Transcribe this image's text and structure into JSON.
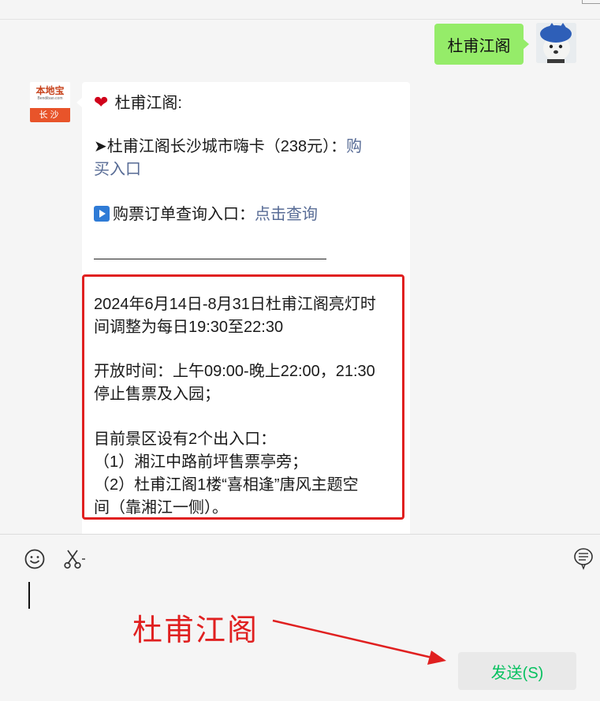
{
  "chat": {
    "outgoing": {
      "text": "杜甫江阁"
    },
    "bot": {
      "avatar": {
        "brand": "本地宝",
        "brand_sub": "Bendibao.com",
        "city": "长沙"
      },
      "heading": "杜甫江阁:",
      "ticket_line": {
        "text": "➤杜甫江阁长沙城市嗨卡（238元）：",
        "link_part1": "购",
        "link_part2": "买入口"
      },
      "order_line": {
        "text": "购票订单查询入口：",
        "link": "点击查询"
      },
      "notice": {
        "line1": "2024年6月14日-8月31日杜甫江阁亮灯时",
        "line2": "间调整为每日19:30至22:30",
        "line3": "开放时间：上午09:00-晚上22:00，21:30",
        "line4": "停止售票及入园；",
        "line5": "目前景区设有2个出入口：",
        "line6": "（1）湘江中路前坪售票亭旁；",
        "line7": "（2）杜甫江阁1楼“喜相逢”唐风主题空",
        "line8": "间（靠湘江一侧）。"
      }
    }
  },
  "toolbar": {
    "emoji_icon": "smiley-icon",
    "scissors_icon": "scissors-icon",
    "history_icon": "chat-history-icon"
  },
  "annotation": {
    "text": "杜甫江阁"
  },
  "send_button": {
    "label": "发送(S)"
  },
  "colors": {
    "accent_green": "#07c160",
    "bubble_green": "#95ec69",
    "link_blue": "#576b95",
    "highlight_red": "#e02020"
  }
}
